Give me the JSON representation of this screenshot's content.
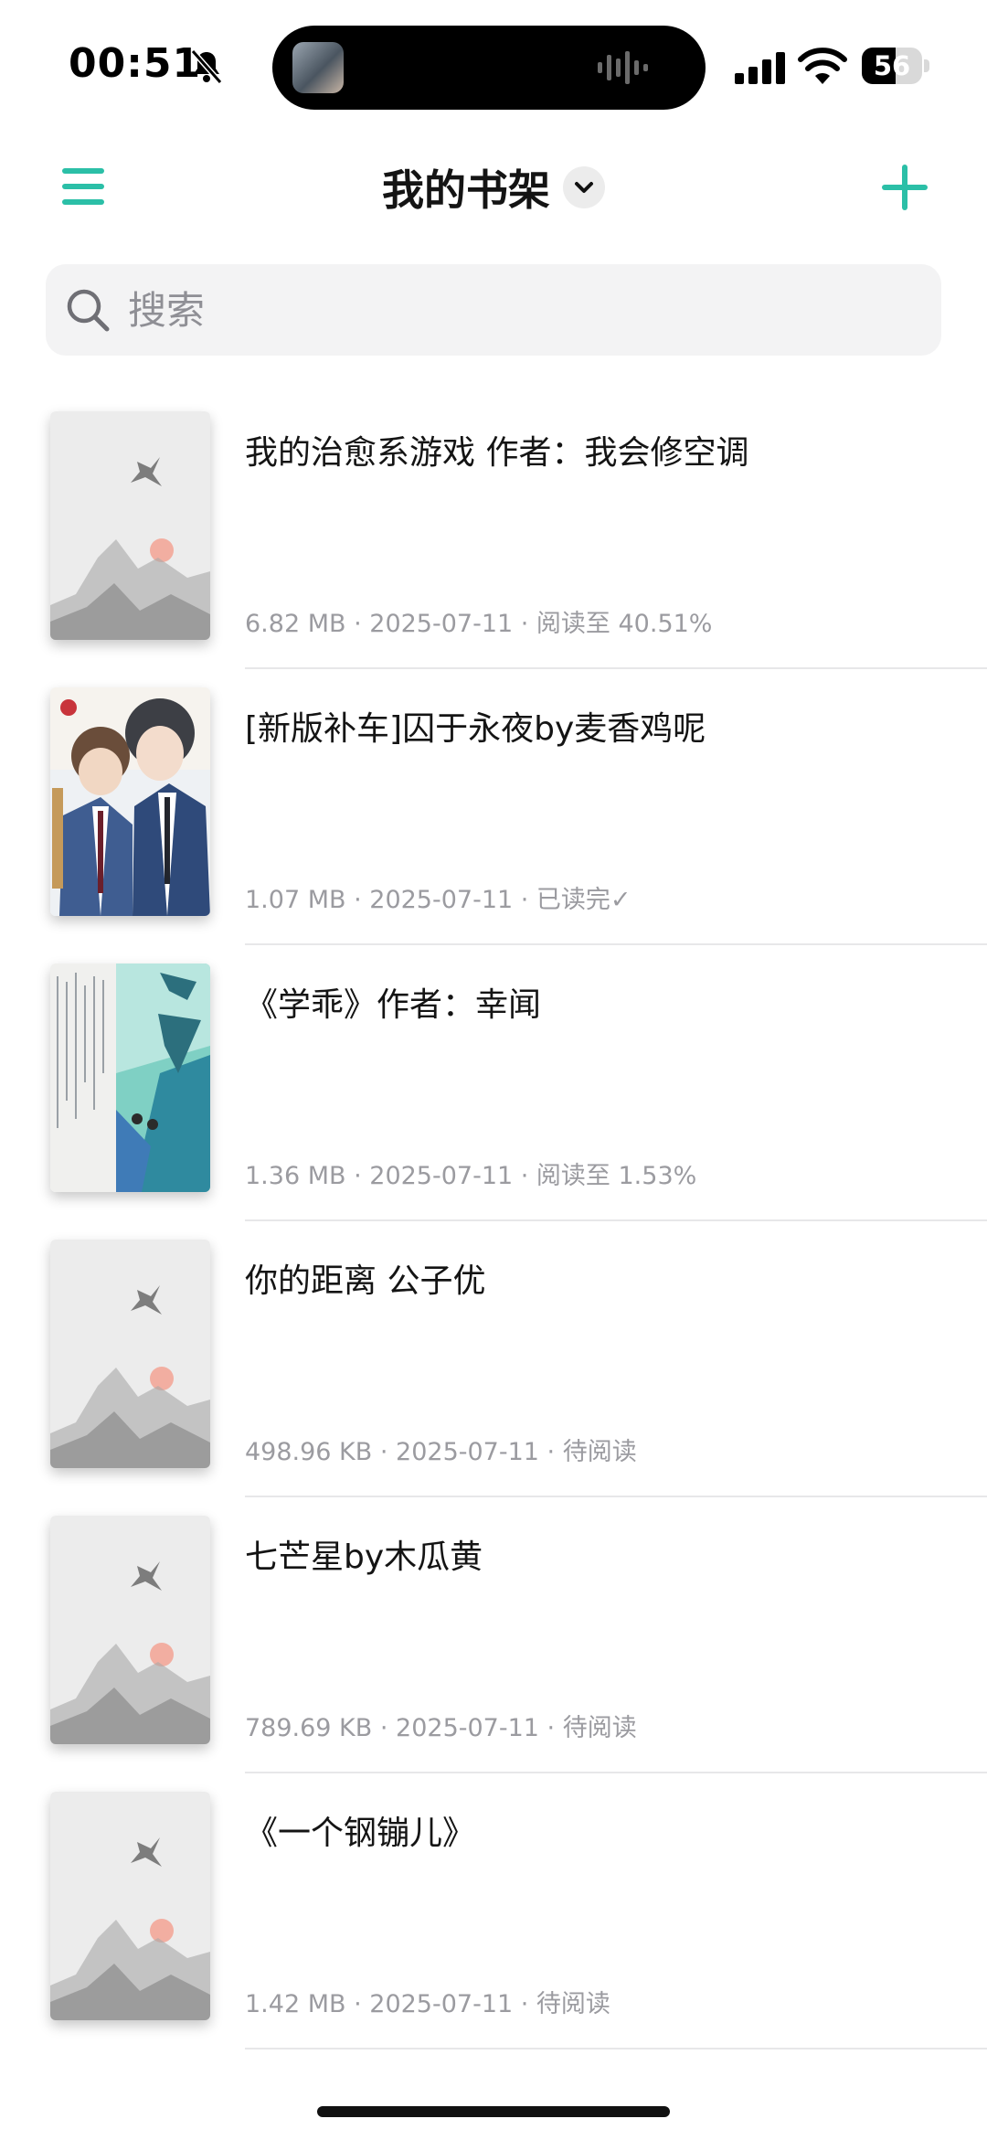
{
  "status_bar": {
    "time": "00:51",
    "battery": "56",
    "battery_level_percent": 56,
    "icons": [
      "bell-slash-icon",
      "signal-icon",
      "wifi-icon",
      "battery-icon"
    ]
  },
  "header": {
    "title": "我的书架",
    "accent_color": "#2bbfa7",
    "icons": [
      "menu-icon",
      "chevron-down-icon",
      "plus-icon"
    ]
  },
  "search": {
    "placeholder": "搜索",
    "value": ""
  },
  "books": [
    {
      "title": "我的治愈系游戏 作者：我会修空调",
      "meta": "6.82 MB · 2025-07-11 · 阅读至 40.51%",
      "cover": "ink-crane"
    },
    {
      "title": "[新版补车]囚于永夜by麦香鸡呢",
      "meta": "1.07 MB · 2025-07-11 · 已读完✓",
      "cover": "illustration-two-boys"
    },
    {
      "title": "《学乖》作者：幸闻",
      "meta": "1.36 MB · 2025-07-11 · 阅读至 1.53%",
      "cover": "illustration-xueguai"
    },
    {
      "title": "你的距离 公子优",
      "meta": "498.96 KB · 2025-07-11 · 待阅读",
      "cover": "ink-crane"
    },
    {
      "title": "七芒星by木瓜黄",
      "meta": "789.69 KB · 2025-07-11 · 待阅读",
      "cover": "ink-crane"
    },
    {
      "title": "《一个钢镚儿》",
      "meta": "1.42 MB · 2025-07-11 · 待阅读",
      "cover": "ink-crane"
    }
  ]
}
